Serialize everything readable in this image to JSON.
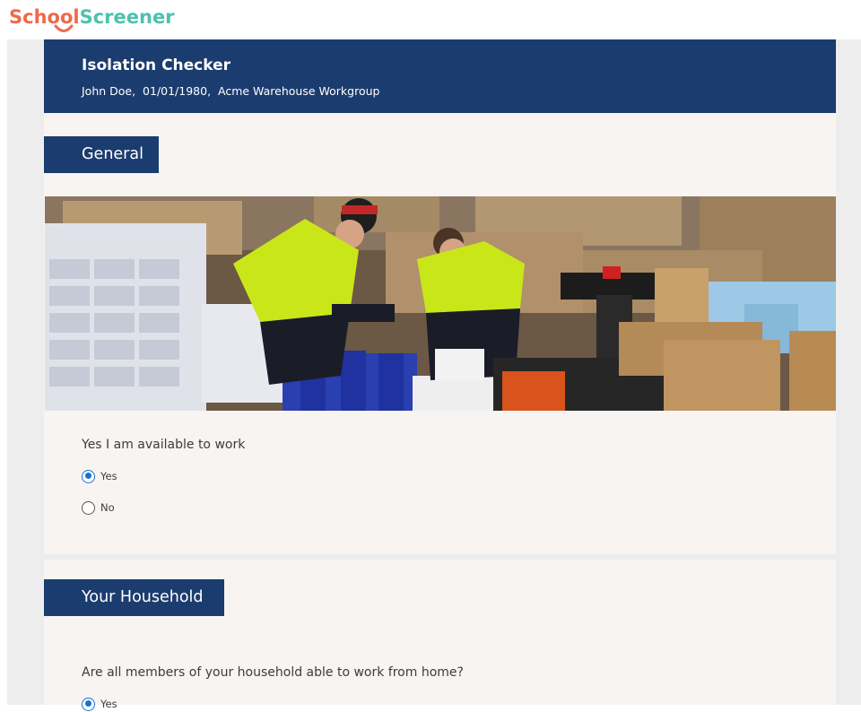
{
  "logo": {
    "school": "School",
    "screener": "Screener"
  },
  "header": {
    "title": "Isolation Checker",
    "subtitle": "John Doe,  01/01/1980,  Acme Warehouse Workgroup"
  },
  "sections": {
    "general": {
      "tab_label": "General",
      "hero_icon": "warehouse-workers-image",
      "question": "Yes I am available to work",
      "options": [
        {
          "label": "Yes",
          "checked": true
        },
        {
          "label": "No",
          "checked": false
        }
      ]
    },
    "household": {
      "tab_label": "Your Household",
      "question": "Are all members of your household able to work from home?",
      "options": [
        {
          "label": "Yes",
          "checked": true
        }
      ]
    }
  },
  "colors": {
    "brand_navy": "#1b3c6e",
    "logo_orange": "#ee6a4a",
    "logo_teal": "#4cc2ad",
    "radio_accent": "#1a6fd1",
    "card_bg": "#f7f4f2"
  }
}
